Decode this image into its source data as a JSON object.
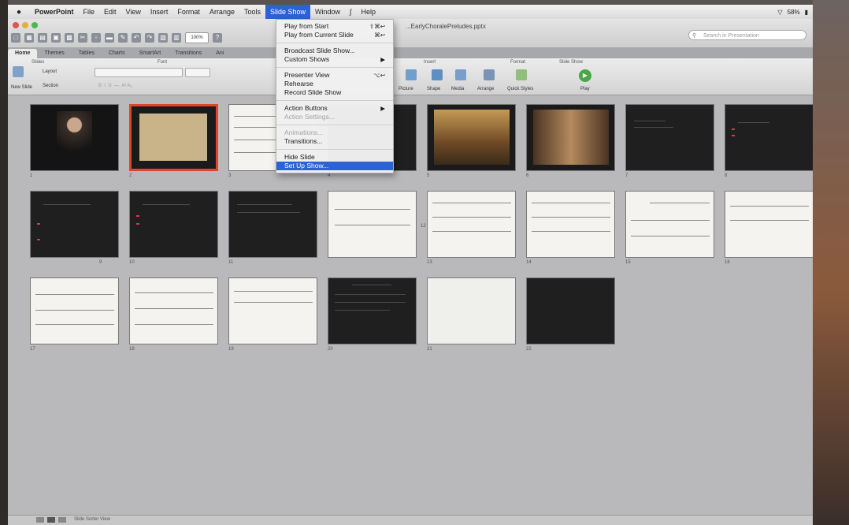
{
  "menubar": {
    "app": "PowerPoint",
    "items": [
      "File",
      "Edit",
      "View",
      "Insert",
      "Format",
      "Arrange",
      "Tools",
      "Slide Show",
      "Window",
      "Help"
    ],
    "active": "Slide Show",
    "battery": "58%"
  },
  "window": {
    "title": "...EarlyChoralePreludes.pptx",
    "zoom": "100%",
    "search_placeholder": "Search in Presentation"
  },
  "ribbon": {
    "tabs": [
      "Home",
      "Themes",
      "Tables",
      "Charts",
      "SmartArt",
      "Transitions",
      "Ani"
    ],
    "active_tab": "Home",
    "group_slides": "Slides",
    "group_font": "Font",
    "group_insert": "Insert",
    "group_format": "Format",
    "group_slideshow": "Slide Show",
    "new_slide": "New Slide",
    "layout": "Layout",
    "section": "Section",
    "picture": "Picture",
    "shape": "Shape",
    "media": "Media",
    "arrange": "Arrange",
    "quick_styles": "Quick Styles",
    "play": "Play"
  },
  "slideshow_menu": {
    "items": [
      {
        "label": "Play from Start",
        "shortcut": "⇧⌘↩",
        "enabled": true,
        "selected": false
      },
      {
        "label": "Play from Current Slide",
        "shortcut": "⌘↩",
        "enabled": true,
        "selected": false
      },
      {
        "sep": true
      },
      {
        "label": "Broadcast Slide Show...",
        "shortcut": "",
        "enabled": true,
        "selected": false
      },
      {
        "label": "Custom Shows",
        "shortcut": "▶",
        "enabled": true,
        "selected": false
      },
      {
        "sep": true
      },
      {
        "label": "Presenter View",
        "shortcut": "⌥↩",
        "enabled": true,
        "selected": false
      },
      {
        "label": "Rehearse",
        "shortcut": "",
        "enabled": true,
        "selected": false
      },
      {
        "label": "Record Slide Show",
        "shortcut": "",
        "enabled": true,
        "selected": false
      },
      {
        "sep": true
      },
      {
        "label": "Action Buttons",
        "shortcut": "▶",
        "enabled": true,
        "selected": false
      },
      {
        "label": "Action Settings...",
        "shortcut": "",
        "enabled": false,
        "selected": false
      },
      {
        "sep": true
      },
      {
        "label": "Animations...",
        "shortcut": "",
        "enabled": false,
        "selected": false
      },
      {
        "label": "Transitions...",
        "shortcut": "",
        "enabled": true,
        "selected": false
      },
      {
        "sep": true
      },
      {
        "label": "Hide Slide",
        "shortcut": "",
        "enabled": true,
        "selected": false
      },
      {
        "label": "Set Up Show...",
        "shortcut": "",
        "enabled": true,
        "selected": true
      }
    ]
  },
  "slides": [
    {
      "n": "1",
      "kind": "portrait"
    },
    {
      "n": "2",
      "kind": "parchment",
      "selected": true
    },
    {
      "n": "3",
      "kind": "paper"
    },
    {
      "n": "4",
      "kind": "dark"
    },
    {
      "n": "5",
      "kind": "church"
    },
    {
      "n": "6",
      "kind": "organ"
    },
    {
      "n": "7",
      "kind": "dark"
    },
    {
      "n": "8",
      "kind": "darkred"
    },
    {
      "n": "9",
      "kind": "darkred"
    },
    {
      "n": "10",
      "kind": "darkred"
    },
    {
      "n": "11",
      "kind": "dark"
    },
    {
      "n": "12",
      "kind": "paper"
    },
    {
      "n": "13",
      "kind": "paper"
    },
    {
      "n": "14",
      "kind": "paper"
    },
    {
      "n": "15",
      "kind": "paper"
    },
    {
      "n": "16",
      "kind": "paper"
    },
    {
      "n": "17",
      "kind": "paper"
    },
    {
      "n": "18",
      "kind": "paper"
    },
    {
      "n": "19",
      "kind": "paper"
    },
    {
      "n": "20",
      "kind": "dark"
    },
    {
      "n": "21",
      "kind": "blank"
    },
    {
      "n": "22",
      "kind": "dark"
    }
  ],
  "status": {
    "view": "Slide Sorter View"
  }
}
